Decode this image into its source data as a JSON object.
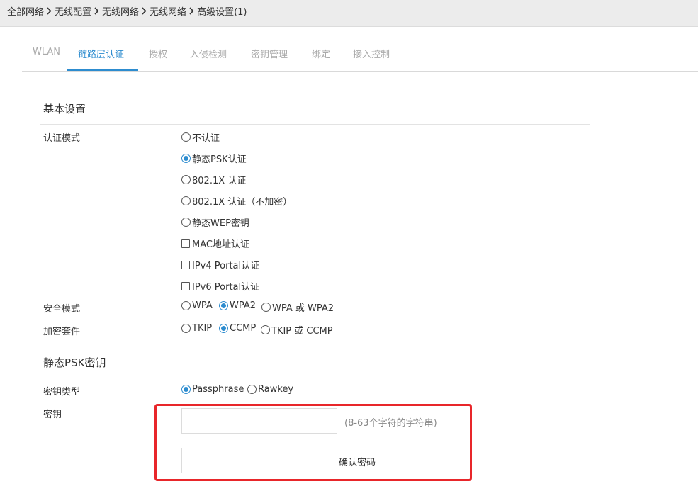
{
  "breadcrumb": [
    "全部网络",
    "无线配置",
    "无线网络",
    "无线网络",
    "高级设置(1)"
  ],
  "tabs": [
    {
      "label": "WLAN",
      "active": false
    },
    {
      "label": "链路层认证",
      "active": true
    },
    {
      "label": "授权",
      "active": false
    },
    {
      "label": "入侵检测",
      "active": false
    },
    {
      "label": "密钥管理",
      "active": false
    },
    {
      "label": "绑定",
      "active": false
    },
    {
      "label": "接入控制",
      "active": false
    }
  ],
  "basic": {
    "title": "基本设置",
    "auth_mode_label": "认证模式",
    "auth_options": [
      {
        "label": "不认证",
        "type": "radio",
        "selected": false
      },
      {
        "label": "静态PSK认证",
        "type": "radio",
        "selected": true
      },
      {
        "label": "802.1X 认证",
        "type": "radio",
        "selected": false
      },
      {
        "label": "802.1X 认证（不加密）",
        "type": "radio",
        "selected": false
      },
      {
        "label": "静态WEP密钥",
        "type": "radio",
        "selected": false
      },
      {
        "label": "MAC地址认证",
        "type": "checkbox",
        "selected": false
      },
      {
        "label": "IPv4 Portal认证",
        "type": "checkbox",
        "selected": false
      },
      {
        "label": "IPv6 Portal认证",
        "type": "checkbox",
        "selected": false
      }
    ],
    "security_mode_label": "安全模式",
    "security_options": [
      {
        "label": "WPA",
        "selected": false
      },
      {
        "label": "WPA2",
        "selected": true
      },
      {
        "label": "WPA 或 WPA2",
        "selected": false
      }
    ],
    "cipher_label": "加密套件",
    "cipher_options": [
      {
        "label": "TKIP",
        "selected": false
      },
      {
        "label": "CCMP",
        "selected": true
      },
      {
        "label": "TKIP 或 CCMP",
        "selected": false
      }
    ]
  },
  "psk": {
    "title": "静态PSK密钥",
    "key_type_label": "密钥类型",
    "key_type_options": [
      {
        "label": "Passphrase",
        "selected": true
      },
      {
        "label": "Rawkey",
        "selected": false
      }
    ],
    "key_label": "密钥",
    "key_value": "",
    "key_hint": "(8-63个字符的字符串)",
    "confirm_value": "",
    "confirm_label": "确认密码"
  },
  "colors": {
    "accent": "#2d8ccf",
    "highlight": "#e8262a",
    "inactive_tab": "#aaaaaa"
  }
}
